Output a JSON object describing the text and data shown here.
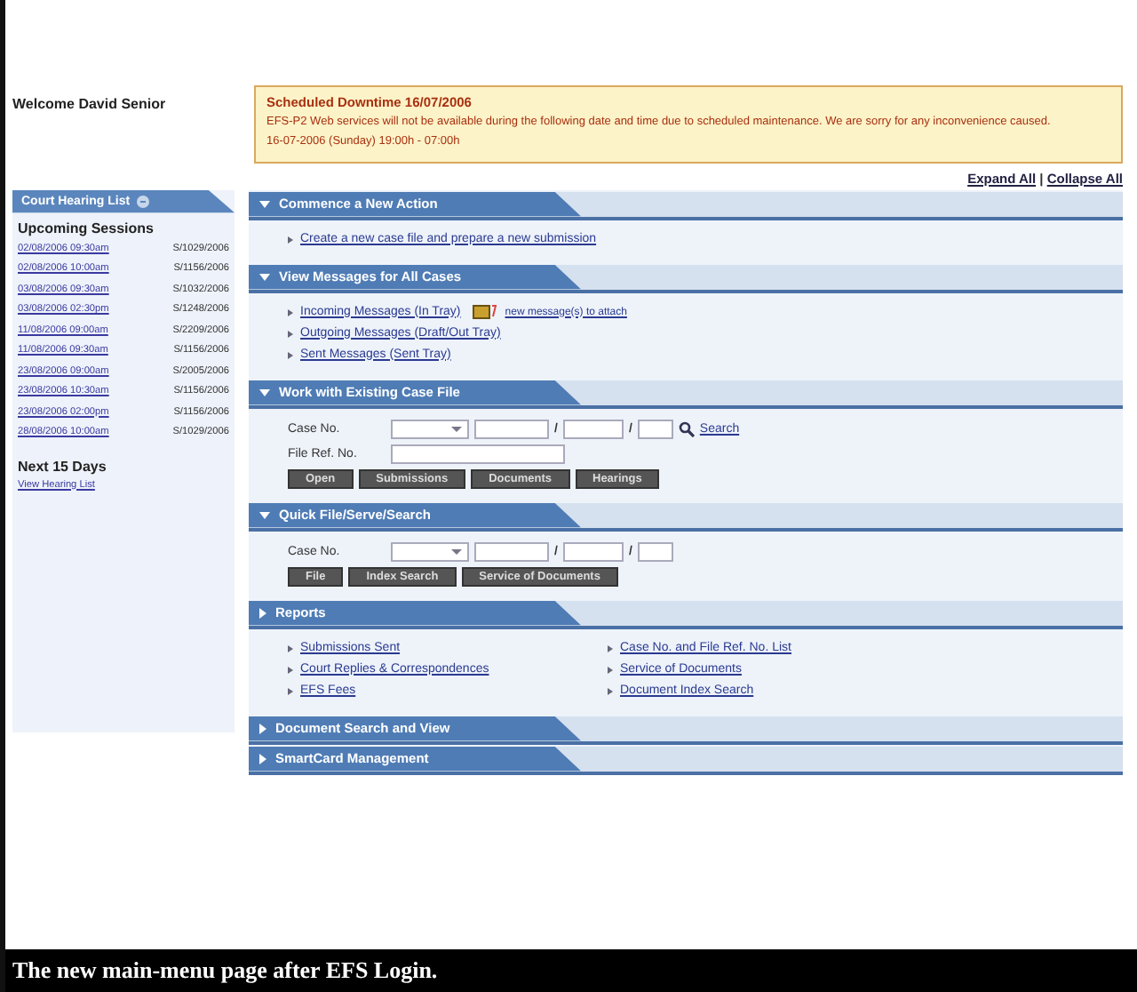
{
  "welcome": "Welcome David Senior",
  "notice": {
    "title": "Scheduled Downtime 16/07/2006",
    "message": "EFS-P2 Web services will not be available during the following date and time due to scheduled maintenance. We are sorry for any inconvenience caused.",
    "period": "16-07-2006 (Sunday) 19:00h - 07:00h"
  },
  "expand_all": "Expand All",
  "separator": "|",
  "collapse_all": "Collapse All",
  "sidebar": {
    "title": "Court Hearing List",
    "expanded": true,
    "upcoming_heading": "Upcoming Sessions",
    "sessions": [
      {
        "time": "02/08/2006 09:30am",
        "case": "S/1029/2006"
      },
      {
        "time": "02/08/2006 10:00am",
        "case": "S/1156/2006"
      },
      {
        "time": "03/08/2006 09:30am",
        "case": "S/1032/2006"
      },
      {
        "time": "03/08/2006 02:30pm",
        "case": "S/1248/2006"
      },
      {
        "time": "11/08/2006 09:00am",
        "case": "S/2209/2006"
      },
      {
        "time": "11/08/2006 09:30am",
        "case": "S/1156/2006"
      },
      {
        "time": "23/08/2006 09:00am",
        "case": "S/2005/2006"
      },
      {
        "time": "23/08/2006 10:30am",
        "case": "S/1156/2006"
      },
      {
        "time": "23/08/2006 02:00pm",
        "case": "S/1156/2006"
      },
      {
        "time": "28/08/2006 10:00am",
        "case": "S/1029/2006"
      }
    ],
    "next_heading": "Next 15 Days",
    "next_link": "View Hearing List"
  },
  "sections": [
    {
      "kind": "links",
      "title": "Commence a New Action",
      "expanded": true,
      "links": [
        "Create a new case file and prepare a new submission"
      ]
    },
    {
      "kind": "messages",
      "title": "View Messages for All Cases",
      "expanded": true,
      "links": [
        "Incoming Messages (In Tray)",
        "Outgoing Messages (Draft/Out Tray)",
        "Sent Messages (Sent Tray)"
      ],
      "note": "new message(s) to attach"
    },
    {
      "kind": "case-form",
      "title": "Work with Existing Case File",
      "expanded": true,
      "case_label": "Case No.",
      "slash": "/",
      "search": "Search",
      "ref_label": "File Ref. No.",
      "buttons": [
        "Open",
        "Submissions",
        "Documents",
        "Hearings"
      ]
    },
    {
      "kind": "quick-form",
      "title": "Quick File/Serve/Search",
      "expanded": true,
      "case_label": "Case No.",
      "slash": "/",
      "buttons": [
        "File",
        "Index Search",
        "Service of Documents"
      ]
    },
    {
      "kind": "reports",
      "title": "Reports",
      "expanded": false,
      "links": [
        "Submissions Sent",
        "Court Replies & Correspondences",
        "EFS Fees",
        "Case No. and File Ref. No. List",
        "Service of Documents",
        "Document Index Search"
      ]
    },
    {
      "kind": "none",
      "title": "Document Search and View",
      "expanded": false
    },
    {
      "kind": "none",
      "title": "SmartCard Management",
      "expanded": false
    }
  ],
  "caption": "The new main-menu page after EFS Login."
}
